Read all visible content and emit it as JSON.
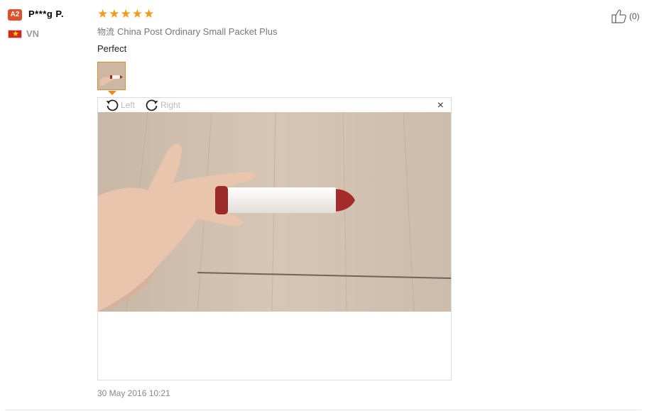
{
  "user": {
    "level": "A2",
    "name": "P***g P.",
    "country": "VN",
    "flag_icon": "vietnam-flag-icon"
  },
  "review": {
    "rating": 5,
    "rating_max": 5,
    "shipping_label": "物流",
    "shipping_method": "China Post Ordinary Small Packet Plus",
    "text": "Perfect",
    "date": "30 May 2016 10:21",
    "helpful_count": "(0)"
  },
  "viewer": {
    "rotate_left_label": "Left",
    "rotate_right_label": "Right",
    "close_symbol": "×",
    "photo_description_icon": "review-photo"
  },
  "colors": {
    "star": "#f29a1e",
    "level_badge": "#e0502a",
    "thumb_border": "#e38a2b"
  }
}
